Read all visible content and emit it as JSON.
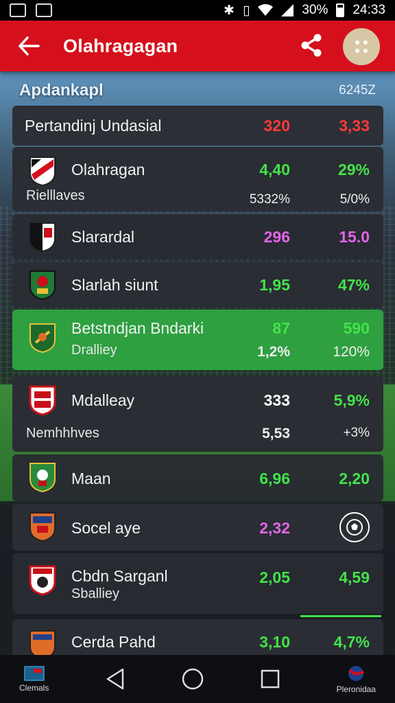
{
  "status_bar": {
    "battery": "30%",
    "time": "24:33"
  },
  "app_bar": {
    "title": "Olahragagan"
  },
  "subheader": {
    "title": "Apdankapl",
    "code": "6245Z"
  },
  "header_row": {
    "name": "Pertandinj Undasial",
    "v1": "320",
    "v2": "3,33"
  },
  "rows": [
    {
      "name": "Olahragan",
      "sub": "Rielllaves",
      "v1": "4,40",
      "v2": "29%",
      "s1": "5332%",
      "s2": "5/0%"
    },
    {
      "name": "Slarardal",
      "v1": "296",
      "v2": "15.0"
    },
    {
      "name": "Slarlah siunt",
      "v1": "1,95",
      "v2": "47%"
    },
    {
      "name": "Betstndjan Bndarki",
      "sub": "Dralliey",
      "v1": "87",
      "v2": "590",
      "s1": "1,2%",
      "s2": "120%"
    },
    {
      "name": "Mdalleay",
      "sub": "Nemhhhves",
      "v1": "333",
      "v2": "5,9%",
      "s1": "5,53",
      "s2": "+3%"
    },
    {
      "name": "Maan",
      "v1": "6,96",
      "v2": "2,20"
    },
    {
      "name": "Socel aye",
      "v1": "2,32"
    },
    {
      "name": "Cbdn Sarganl",
      "sub": "Sballiey",
      "v1": "2,05",
      "v2": "4,59"
    },
    {
      "name": "Cerda Pahd",
      "v1": "3,10",
      "v2": "4,7%"
    }
  ],
  "nav": {
    "left_label": "Clemals",
    "right_label": "Pleronidaa"
  },
  "colors": {
    "app_bar": "#d5101c",
    "highlight": "#2ea040",
    "positive": "#43e34a",
    "negative": "#ff3a3a",
    "accent": "#e264e8"
  }
}
